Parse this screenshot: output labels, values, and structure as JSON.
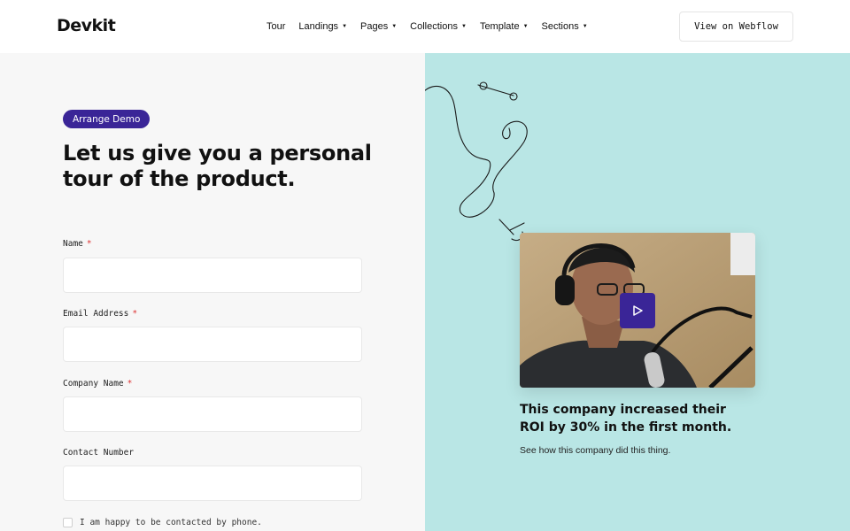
{
  "header": {
    "logo": "Devkit",
    "nav": [
      {
        "label": "Tour",
        "dropdown": false
      },
      {
        "label": "Landings",
        "dropdown": true
      },
      {
        "label": "Pages",
        "dropdown": true
      },
      {
        "label": "Collections",
        "dropdown": true
      },
      {
        "label": "Template",
        "dropdown": true
      },
      {
        "label": "Sections",
        "dropdown": true
      }
    ],
    "cta_label": "View on Webflow"
  },
  "form": {
    "badge": "Arrange Demo",
    "title": "Let us give you a personal tour of the product.",
    "fields": [
      {
        "label": "Name",
        "required": true,
        "value": ""
      },
      {
        "label": "Email Address",
        "required": true,
        "value": ""
      },
      {
        "label": "Company Name",
        "required": true,
        "value": ""
      },
      {
        "label": "Contact Number",
        "required": false,
        "value": ""
      }
    ],
    "required_mark": "*",
    "checkbox_label": "I am happy to be contacted by phone.",
    "checkbox_checked": false
  },
  "showcase": {
    "video_icon": "play-icon",
    "case_title": "This company increased their ROI by 30% in the first month.",
    "case_subtitle": "See how this company did this thing."
  },
  "colors": {
    "accent": "#3a2597",
    "right_bg": "#b9e6e5",
    "left_bg": "#f7f7f7",
    "required": "#dd3333"
  }
}
